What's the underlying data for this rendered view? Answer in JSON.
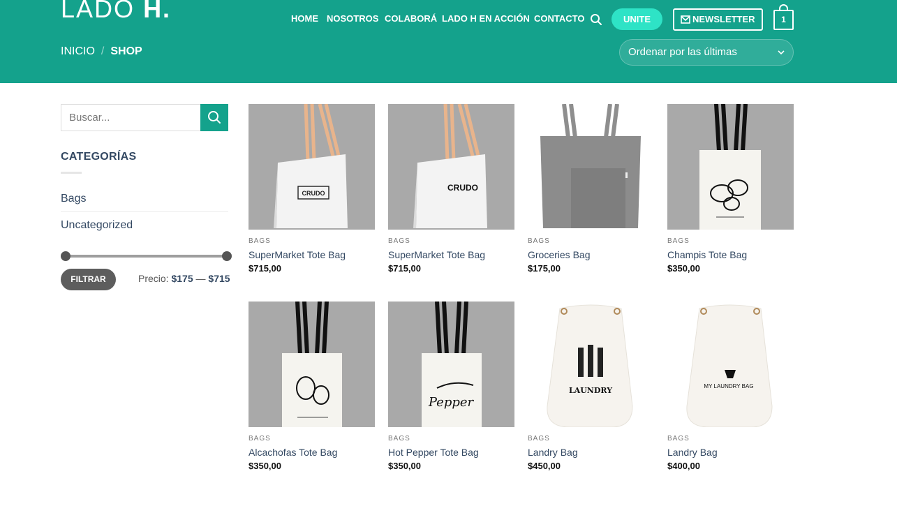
{
  "brand": {
    "logo_light": "LADO",
    "logo_bold": "H."
  },
  "nav": [
    {
      "label": "HOME"
    },
    {
      "label": "NOSOTROS"
    },
    {
      "label": "COLABORÁ"
    },
    {
      "label": "LADO H EN ACCIÓN"
    },
    {
      "label": "CONTACTO"
    }
  ],
  "header_buttons": {
    "unite": "UNITE",
    "newsletter": "NEWSLETTER",
    "cart_count": "1"
  },
  "breadcrumb": {
    "home": "INICIO",
    "separator": "/",
    "current": "SHOP"
  },
  "sort": {
    "selected": "Ordenar por las últimas"
  },
  "sidebar": {
    "search_placeholder": "Buscar...",
    "categories_title": "CATEGORÍAS",
    "categories": [
      {
        "label": "Bags"
      },
      {
        "label": "Uncategorized"
      }
    ],
    "filter_button": "FILTRAR",
    "price_prefix": "Precio:",
    "price_min": "$175",
    "price_dash": "—",
    "price_max": "$715"
  },
  "products": [
    {
      "category": "BAGS",
      "name": "SuperMarket Tote Bag",
      "price": "$715,00",
      "image": "white-tote-leather-handles",
      "print": "CRUDO"
    },
    {
      "category": "BAGS",
      "name": "SuperMarket Tote Bag",
      "price": "$715,00",
      "image": "white-tote-leather-handles",
      "print": "CRUDO"
    },
    {
      "category": "BAGS",
      "name": "Groceries Bag",
      "price": "$175,00",
      "image": "grey-canvas-bag"
    },
    {
      "category": "BAGS",
      "name": "Champis Tote Bag",
      "price": "$350,00",
      "image": "tote-mushroom-print"
    },
    {
      "category": "BAGS",
      "name": "Alcachofas Tote Bag",
      "price": "$350,00",
      "image": "tote-artichoke-print"
    },
    {
      "category": "BAGS",
      "name": "Hot Pepper Tote Bag",
      "price": "$350,00",
      "image": "tote-pepper-print",
      "print": "Pepper"
    },
    {
      "category": "BAGS",
      "name": "Landry Bag",
      "price": "$450,00",
      "image": "laundry-drawstring-bag",
      "print": "LAUNDRY"
    },
    {
      "category": "BAGS",
      "name": "Landry Bag",
      "price": "$400,00",
      "image": "laundry-drawstring-bag",
      "print": "MY LAUNDRY BAG"
    }
  ],
  "colors": {
    "header": "#14a28c",
    "accent": "#2ee3c6",
    "link": "#334862",
    "filter_button": "#5d5d5d"
  }
}
